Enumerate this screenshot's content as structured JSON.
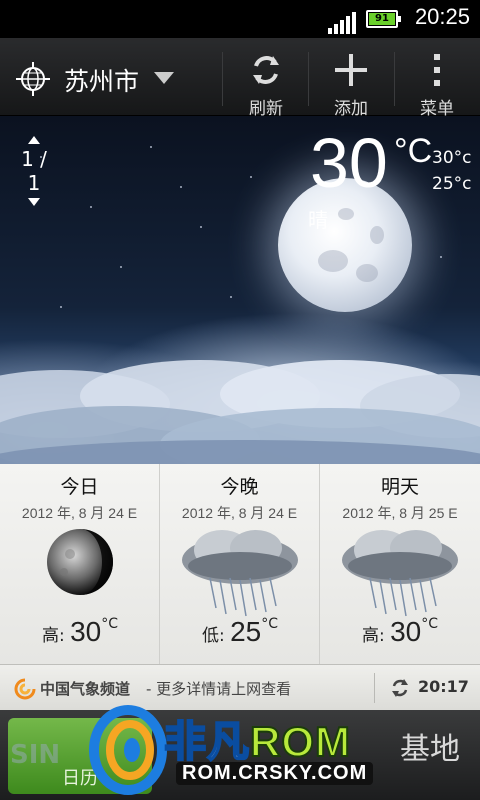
{
  "status_bar": {
    "time": "20:25",
    "battery": "91",
    "signal_bars": 4
  },
  "action_bar": {
    "city": "苏州市",
    "refresh_label": "刷新",
    "add_label": "添加",
    "menu_label": "菜单"
  },
  "current": {
    "pager": "1 / 1",
    "temperature": "30",
    "unit": "°C",
    "high": "30°c",
    "low": "25°c",
    "condition": "晴"
  },
  "forecast": [
    {
      "title": "今日",
      "date": "2012 年, 8 月 24 E",
      "label": "高:",
      "temp": "30",
      "unit": "°C",
      "icon": "moon-icon"
    },
    {
      "title": "今晚",
      "date": "2012 年, 8 月 24 E",
      "label": "低:",
      "temp": "25",
      "unit": "°C",
      "icon": "rain-cloud-icon"
    },
    {
      "title": "明天",
      "date": "2012 年, 8 月 25 E",
      "label": "高:",
      "temp": "30",
      "unit": "°C",
      "icon": "rain-cloud-icon"
    }
  ],
  "news": {
    "source": "中国气象频道",
    "message": "- 更多详情请上网查看",
    "updated": "20:17"
  },
  "bottom": {
    "button_label": "日历"
  },
  "watermark": {
    "name_part1": "非凡",
    "name_part2": "ROM",
    "url": "ROM.CRSKY.COM",
    "base": "基地",
    "faint": "SIN"
  },
  "colors": {
    "accent_green": "#6ad02b",
    "panel_bg": "#f0f0ed"
  }
}
